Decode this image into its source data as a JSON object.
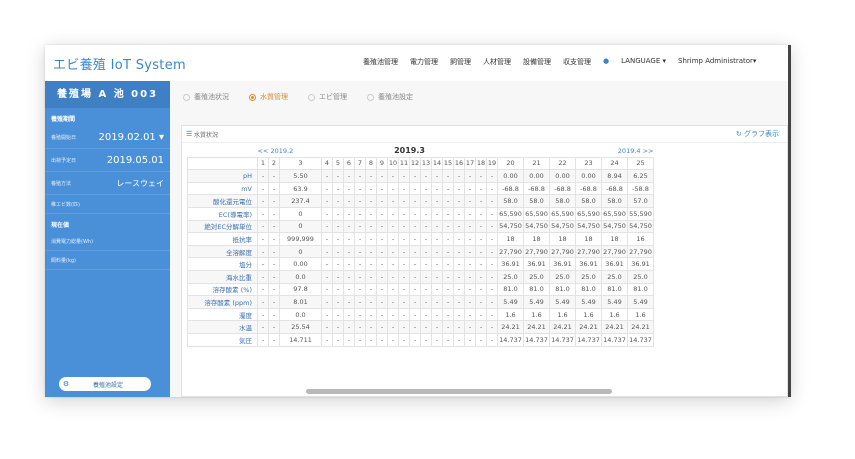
{
  "header": {
    "app_title": "エビ養殖 IoT System",
    "nav": [
      "養殖池管理",
      "電力管理",
      "飼管理",
      "人材管理",
      "設備管理",
      "収支管理"
    ],
    "lang_dot": "●",
    "language": "LANGUAGE ▾",
    "user": "Shrimp Administrator▾"
  },
  "sidebar": {
    "pond_name": "養殖場 A 池 003",
    "section1": "養殖期間",
    "rows": [
      {
        "label": "養殖開始日",
        "value": "2019.02.01 ▾"
      },
      {
        "label": "出荷予定日",
        "value": "2019.05.01"
      },
      {
        "label": "養殖方法",
        "value": "レースウェイ"
      },
      {
        "label": "稚エビ数(匹)",
        "value": ""
      }
    ],
    "section2": "現在値",
    "rows2": [
      {
        "label": "消費電力総量(Wh)",
        "value": ""
      },
      {
        "label": "飼料量(kg)",
        "value": ""
      }
    ],
    "settings_icon": "gear-icon",
    "settings_label": "養殖池設定"
  },
  "tabs": [
    {
      "label": "養殖池状況",
      "active": false
    },
    {
      "label": "水質管理",
      "active": true
    },
    {
      "label": "エビ管理",
      "active": false
    },
    {
      "label": "養殖池設定",
      "active": false
    }
  ],
  "panel": {
    "title": "水質状況",
    "graph_button": "グラフ表示",
    "prev_link": "<< 2019.2",
    "month": "2019.3",
    "next_link": "2019.4 >>"
  },
  "table": {
    "days": [
      "1",
      "2",
      "3",
      "4",
      "5",
      "6",
      "7",
      "8",
      "9",
      "10",
      "11",
      "12",
      "13",
      "14",
      "15",
      "16",
      "17",
      "18",
      "19",
      "20",
      "21",
      "22",
      "23",
      "24",
      "25"
    ],
    "rows": [
      {
        "label": "pH",
        "day3": "5.50",
        "tail": [
          "0.00",
          "0.00",
          "0.00",
          "0.00",
          "8.94",
          "6.25"
        ]
      },
      {
        "label": "mV",
        "day3": "63.9",
        "tail": [
          "-68.8",
          "-68.8",
          "-68.8",
          "-68.8",
          "-68.8",
          "-58.8"
        ]
      },
      {
        "label": "酸化還元電位",
        "day3": "237.4",
        "tail": [
          "58.0",
          "58.0",
          "58.0",
          "58.0",
          "58.0",
          "57.0"
        ]
      },
      {
        "label": "EC(導電率)",
        "day3": "0",
        "tail": [
          "65,590",
          "65,590",
          "65,590",
          "65,590",
          "65,590",
          "55,590"
        ]
      },
      {
        "label": "絶対EC分解単位",
        "day3": "0",
        "tail": [
          "54,750",
          "54,750",
          "54,750",
          "54,750",
          "54,750",
          "54,750"
        ]
      },
      {
        "label": "抵抗率",
        "day3": "999,999",
        "tail": [
          "18",
          "18",
          "18",
          "18",
          "18",
          "16"
        ]
      },
      {
        "label": "全溶解度",
        "day3": "0",
        "tail": [
          "27,790",
          "27,790",
          "27,790",
          "27,790",
          "27,790",
          "27,790"
        ]
      },
      {
        "label": "塩分",
        "day3": "0.00",
        "tail": [
          "36.91",
          "36.91",
          "36.91",
          "36.91",
          "36.91",
          "36.91"
        ]
      },
      {
        "label": "海水比重",
        "day3": "0.0",
        "tail": [
          "25.0",
          "25.0",
          "25.0",
          "25.0",
          "25.0",
          "25.0"
        ]
      },
      {
        "label": "溶存酸素 (%)",
        "day3": "97.8",
        "tail": [
          "81.0",
          "81.0",
          "81.0",
          "81.0",
          "81.0",
          "81.0"
        ]
      },
      {
        "label": "溶存酸素 (ppm)",
        "day3": "8.01",
        "tail": [
          "5.49",
          "5.49",
          "5.49",
          "5.49",
          "5.49",
          "5.49"
        ]
      },
      {
        "label": "濁度",
        "day3": "0.0",
        "tail": [
          "1.6",
          "1.6",
          "1.6",
          "1.6",
          "1.6",
          "1.6"
        ]
      },
      {
        "label": "水温",
        "day3": "25.54",
        "tail": [
          "24.21",
          "24.21",
          "24.21",
          "24.21",
          "24.21",
          "24.21"
        ]
      },
      {
        "label": "気圧",
        "day3": "14.711",
        "tail": [
          "14.737",
          "14.737",
          "14.737",
          "14.737",
          "14.737",
          "14.737"
        ]
      }
    ],
    "empty": "-"
  },
  "colors": {
    "accent": "#3a87c8",
    "sidebar": "#4a90d9",
    "active_tab": "#e58a2a"
  }
}
